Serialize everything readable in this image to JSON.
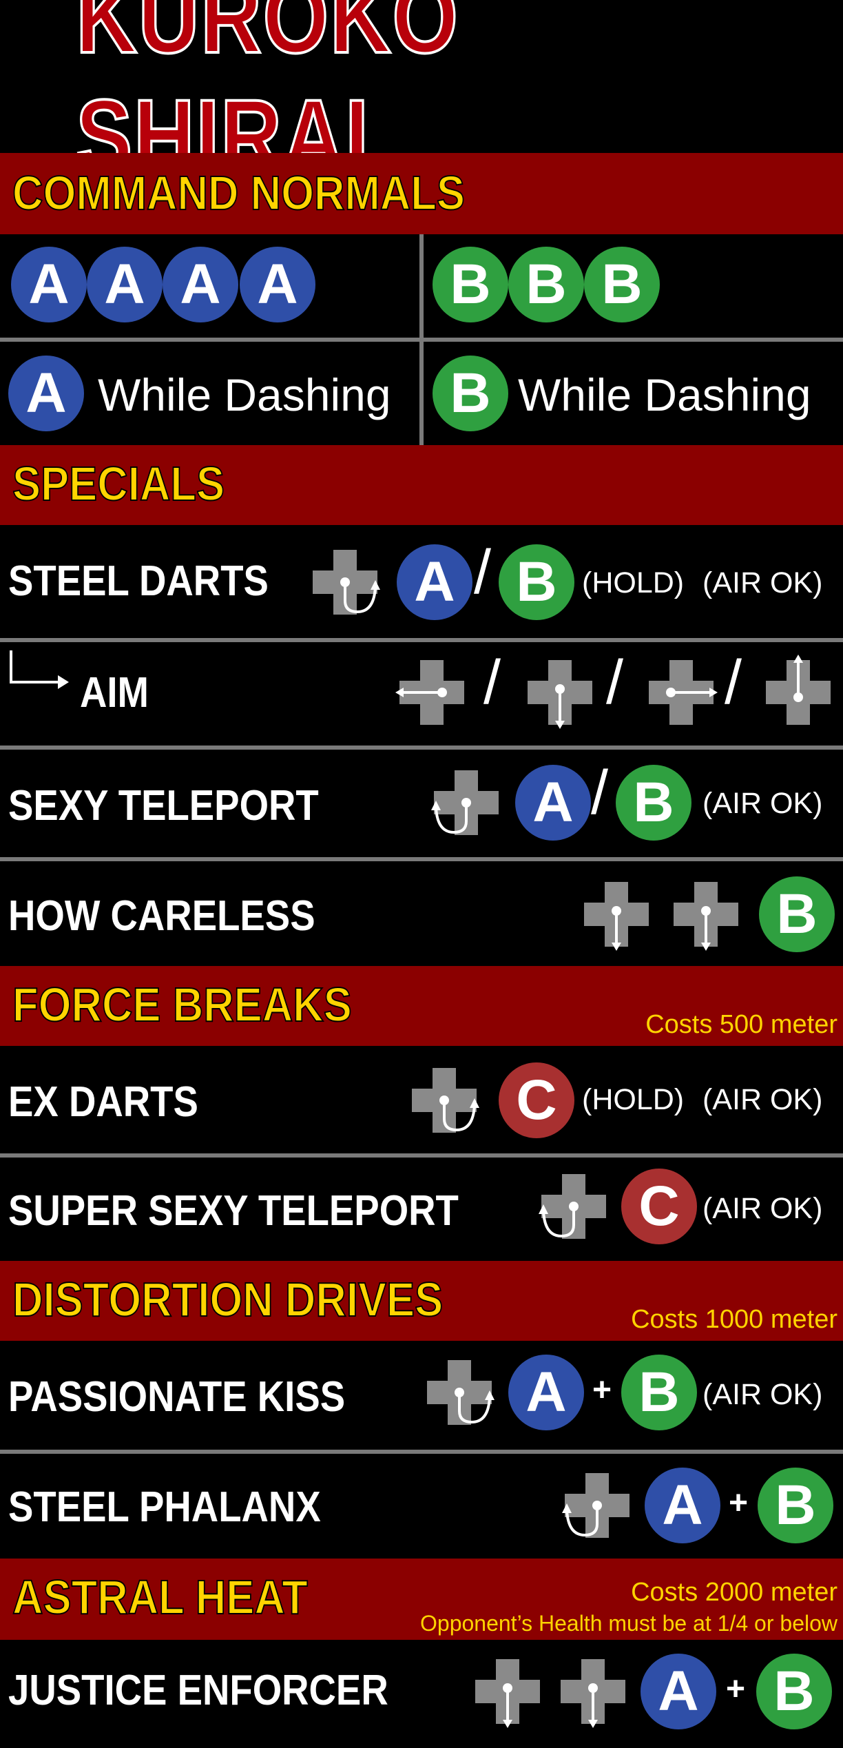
{
  "title": "KUROKO SHIRAI",
  "sections": {
    "command_normals": "COMMAND NORMALS",
    "specials": "SPECIALS",
    "force_breaks": "FORCE BREAKS",
    "force_breaks_cost": "Costs 500 meter",
    "distortion_drives": "DISTORTION DRIVES",
    "distortion_drives_cost": "Costs 1000 meter",
    "astral_heat": "ASTRAL HEAT",
    "astral_heat_cost": "Costs 2000 meter",
    "astral_heat_condition": "Opponent’s Health must be at 1/4 or below"
  },
  "buttons": {
    "a": "A",
    "b": "B",
    "c": "C"
  },
  "command_normals": {
    "a_while_dashing": "While Dashing",
    "b_while_dashing": "While Dashing"
  },
  "moves": {
    "steel_darts": {
      "name": "STEEL DARTS",
      "hold": "(HOLD)",
      "air": "(AIR OK)"
    },
    "aim": {
      "name": "AIM"
    },
    "sexy_teleport": {
      "name": "SEXY TELEPORT",
      "air": "(AIR OK)"
    },
    "how_careless": {
      "name": "HOW CARELESS"
    },
    "ex_darts": {
      "name": "EX DARTS",
      "hold": "(HOLD)",
      "air": "(AIR OK)"
    },
    "super_sexy_teleport": {
      "name": "SUPER SEXY TELEPORT",
      "air": "(AIR OK)"
    },
    "passionate_kiss": {
      "name": "PASSIONATE KISS",
      "air": "(AIR OK)"
    },
    "steel_phalanx": {
      "name": "STEEL PHALANX"
    },
    "justice_enforcer": {
      "name": "JUSTICE ENFORCER"
    }
  },
  "symbols": {
    "slash": "/",
    "plus": "+"
  },
  "colors": {
    "section_bg": "#8b0000",
    "section_text": "#ffd400",
    "button_a": "#2f4fa8",
    "button_b": "#2fa040",
    "button_c": "#a83030",
    "dpad": "#8a8a8a"
  }
}
